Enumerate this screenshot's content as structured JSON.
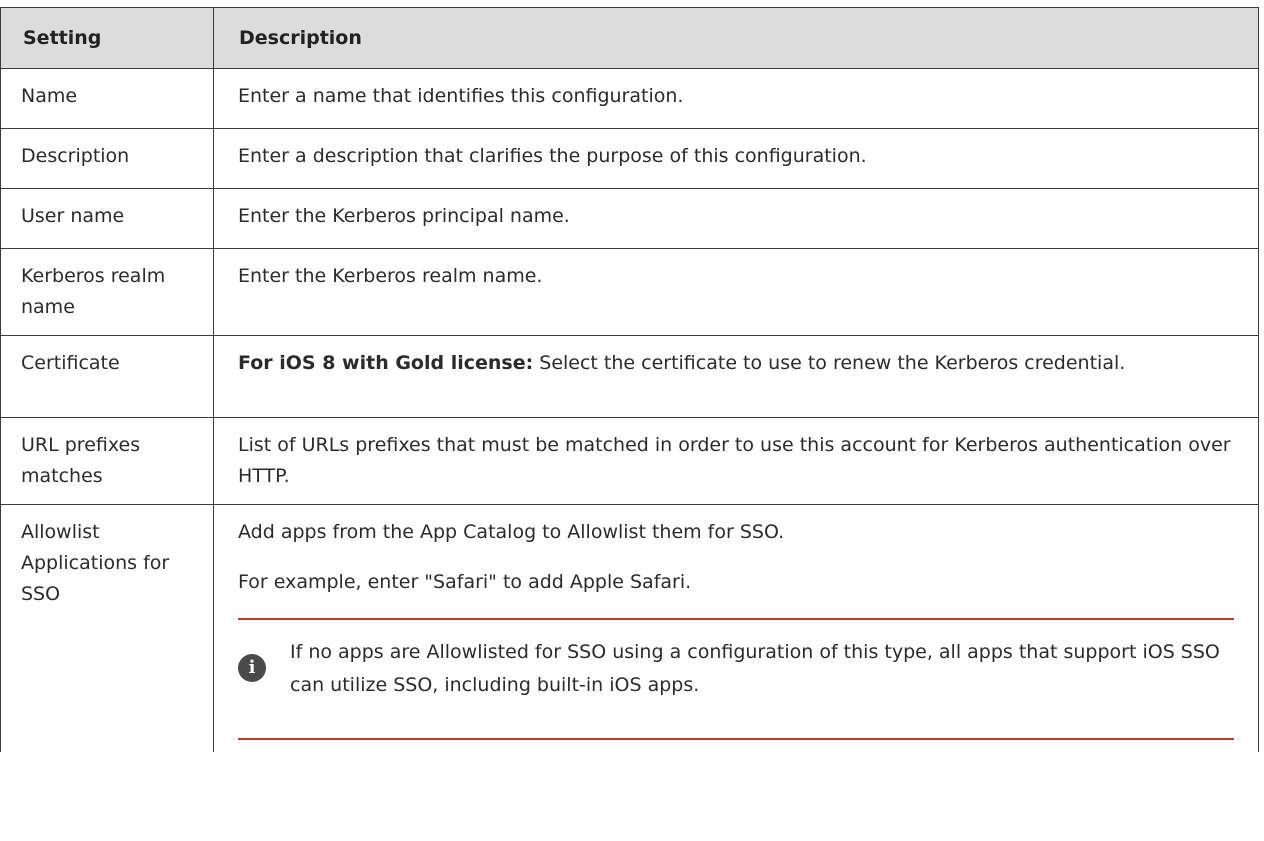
{
  "table": {
    "headers": {
      "setting": "Setting",
      "description": "Description"
    },
    "rows": [
      {
        "setting": "Name",
        "description": "Enter a name that identifies this configuration."
      },
      {
        "setting": "Description",
        "description": "Enter a description that clarifies the purpose of this configuration."
      },
      {
        "setting": "User name",
        "description": "Enter the Kerberos principal name."
      },
      {
        "setting": "Kerberos realm name",
        "description": "Enter the Kerberos realm name."
      },
      {
        "setting": "Certificate",
        "description_bold": "For iOS 8 with Gold license:",
        "description": " Select the certificate to use to renew the Kerberos credential."
      },
      {
        "setting": "URL prefixes matches",
        "description": "List of URLs prefixes that must be matched in order to use this account for Kerberos authentication over HTTP."
      },
      {
        "setting": "Allowlist Applications for SSO",
        "paragraphs": [
          "Add apps from the App Catalog to Allowlist them for SSO.",
          "For example, enter \"Safari\" to add Apple Safari."
        ],
        "note": {
          "icon": "info-icon",
          "icon_glyph": "i",
          "text": "If no apps are Allowlisted for SSO using a configuration of this type, all apps that support iOS SSO can utilize SSO, including built-in iOS apps."
        }
      }
    ]
  },
  "colors": {
    "header_bg": "#dcdcdc",
    "border": "#3a3a3a",
    "note_rule": "#c0392b",
    "icon_bg": "#4a4a4a"
  }
}
